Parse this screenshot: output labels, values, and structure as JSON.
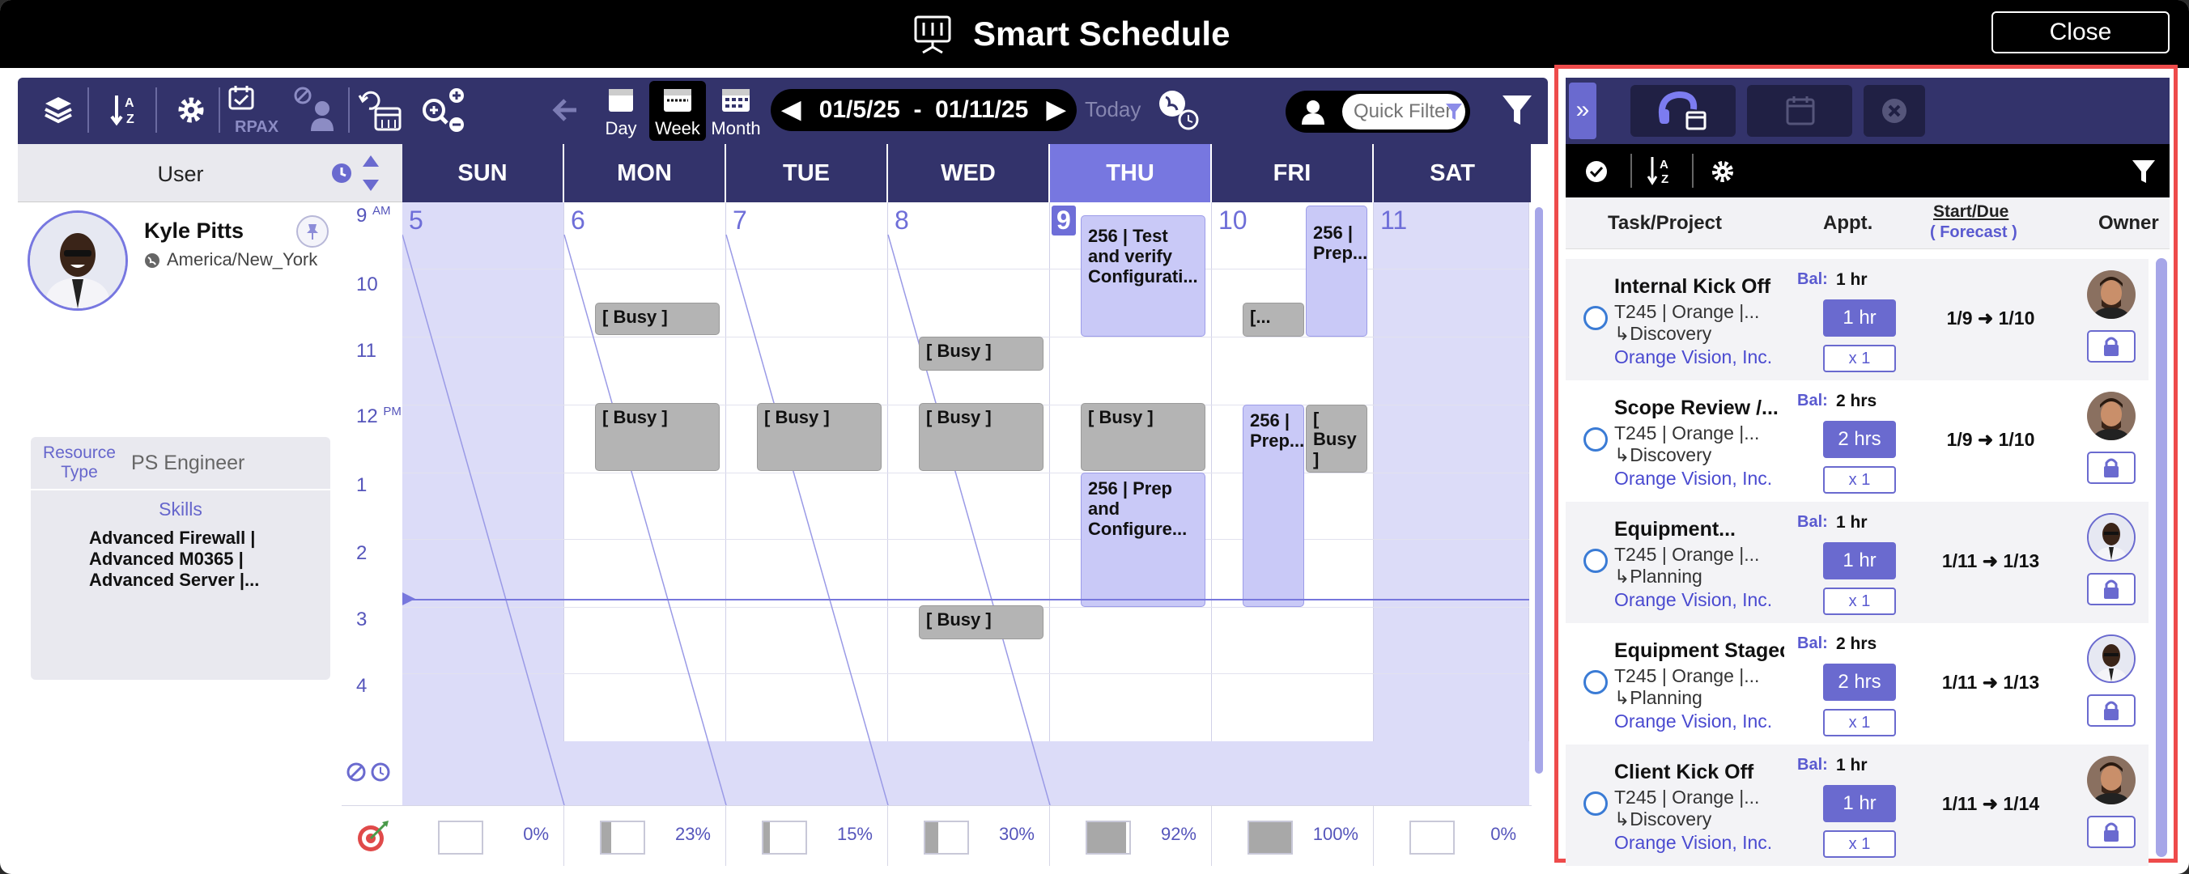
{
  "title": "Smart Schedule",
  "close_label": "Close",
  "toolbar": {
    "view_day": "Day",
    "view_week": "Week",
    "view_month": "Month",
    "date_range": "01/5/25  -  01/11/25",
    "today": "Today",
    "quick_filter_placeholder": "Quick Filter",
    "rpax_label": "RPAX"
  },
  "calendar": {
    "user_header": "User",
    "days": [
      {
        "name": "SUN",
        "num": "5"
      },
      {
        "name": "MON",
        "num": "6"
      },
      {
        "name": "TUE",
        "num": "7"
      },
      {
        "name": "WED",
        "num": "8"
      },
      {
        "name": "THU",
        "num": "9"
      },
      {
        "name": "FRI",
        "num": "10"
      },
      {
        "name": "SAT",
        "num": "11"
      }
    ],
    "today_index": 4,
    "hours": [
      "9",
      "10",
      "11",
      "12",
      "1",
      "2",
      "3",
      "4"
    ],
    "am": "AM",
    "pm": "PM",
    "busy_label": "[ Busy ]",
    "events": {
      "thu_1": "256 | Test and verify Configurati...",
      "thu_2": "256 | Prep and Configure...",
      "fri_1": "256 | Prep...",
      "fri_2": "[...",
      "fri_3": "256 | Prep...",
      "fri_4": "[ Busy ]"
    }
  },
  "user": {
    "name": "Kyle Pitts",
    "timezone": "America/New_York",
    "resource_type_label": "Resource Type",
    "resource_type": "PS Engineer",
    "skills_label": "Skills",
    "skills": [
      "Advanced Firewall |",
      "Advanced M0365 |",
      "Advanced Server |..."
    ]
  },
  "utilization": [
    {
      "pct": "0%",
      "fill": 0
    },
    {
      "pct": "23%",
      "fill": 0.23
    },
    {
      "pct": "15%",
      "fill": 0.15
    },
    {
      "pct": "30%",
      "fill": 0.3
    },
    {
      "pct": "92%",
      "fill": 0.92
    },
    {
      "pct": "100%",
      "fill": 1.0
    },
    {
      "pct": "0%",
      "fill": 0
    }
  ],
  "panel": {
    "col_task": "Task/Project",
    "col_appt": "Appt.",
    "col_start": "Start/Due",
    "col_forecast": "( Forecast )",
    "col_owner": "Owner",
    "bal_label": "Bal:",
    "tasks": [
      {
        "name": "Internal Kick Off",
        "code": "T245 | Orange |...",
        "phase": "↳Discovery",
        "client": "Orange Vision, Inc.",
        "bal": "1 hr",
        "hrs": "1 hr",
        "mult": "x 1",
        "dates": "1/9 ➜ 1/10"
      },
      {
        "name": "Scope Review /...",
        "code": "T245 | Orange |...",
        "phase": "↳Discovery",
        "client": "Orange Vision, Inc.",
        "bal": "2 hrs",
        "hrs": "2 hrs",
        "mult": "x 1",
        "dates": "1/9 ➜ 1/10"
      },
      {
        "name": "Equipment...",
        "code": "T245 | Orange |...",
        "phase": "↳Planning",
        "client": "Orange Vision, Inc.",
        "bal": "1 hr",
        "hrs": "1 hr",
        "mult": "x 1",
        "dates": "1/11 ➜ 1/13"
      },
      {
        "name": "Equipment Staged...",
        "code": "T245 | Orange |...",
        "phase": "↳Planning",
        "client": "Orange Vision, Inc.",
        "bal": "2 hrs",
        "hrs": "2 hrs",
        "mult": "x 1",
        "dates": "1/11 ➜ 1/13"
      },
      {
        "name": "Client Kick Off",
        "code": "T245 | Orange |...",
        "phase": "↳Discovery",
        "client": "Orange Vision, Inc.",
        "bal": "1 hr",
        "hrs": "1 hr",
        "mult": "x 1",
        "dates": "1/11 ➜ 1/14"
      }
    ]
  },
  "colors": {
    "toolbar": "#33336b",
    "accent": "#6a6acf",
    "today": "#7777e0",
    "busy": "#b4b4b4",
    "highlight_border": "#ee4b4b"
  }
}
